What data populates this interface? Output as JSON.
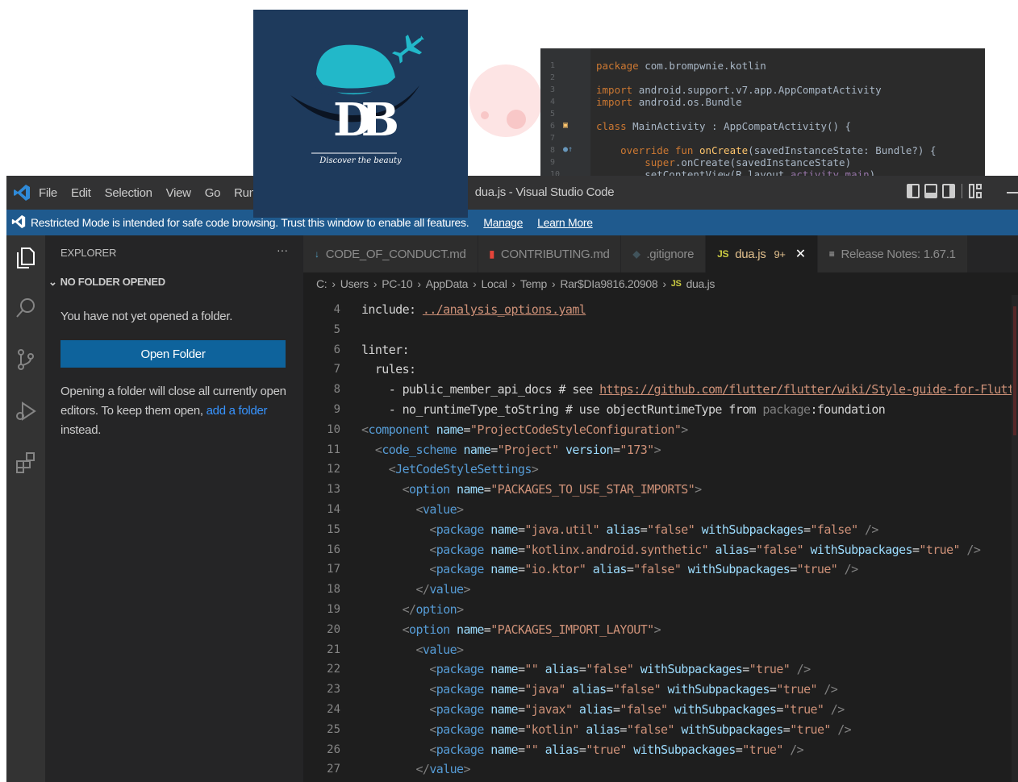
{
  "logo": {
    "tagline": "Discover the beauty",
    "letters": "DB"
  },
  "android_snippet": {
    "lines": [
      {
        "num": "1",
        "parts": [
          [
            "kw",
            "package "
          ],
          [
            "cls",
            "com.brompwnie.kotlin"
          ]
        ]
      },
      {
        "num": "2",
        "parts": []
      },
      {
        "num": "3",
        "parts": [
          [
            "kw",
            "import "
          ],
          [
            "cls",
            "android.support.v7.app.AppCompatActivity"
          ]
        ]
      },
      {
        "num": "4",
        "parts": [
          [
            "kw",
            "import "
          ],
          [
            "cls",
            "android.os.Bundle"
          ]
        ]
      },
      {
        "num": "5",
        "parts": []
      },
      {
        "num": "6",
        "parts": [
          [
            "kw",
            "class "
          ],
          [
            "cls",
            "MainActivity : AppCompatActivity() {"
          ]
        ]
      },
      {
        "num": "7",
        "parts": []
      },
      {
        "num": "8",
        "parts": [
          [
            "cls",
            "    "
          ],
          [
            "kw",
            "override fun "
          ],
          [
            "fn",
            "onCreate"
          ],
          [
            "cls",
            "(savedInstanceState: Bundle?) {"
          ]
        ]
      },
      {
        "num": "9",
        "parts": [
          [
            "cls",
            "        "
          ],
          [
            "kw",
            "super"
          ],
          [
            "cls",
            ".onCreate(savedInstanceState)"
          ]
        ]
      },
      {
        "num": "10",
        "parts": [
          [
            "cls",
            "        setContentView(R.layout."
          ],
          [
            "sup",
            "activity_main"
          ],
          [
            "cls",
            ")"
          ]
        ]
      }
    ]
  },
  "vscode": {
    "menu": [
      "File",
      "Edit",
      "Selection",
      "View",
      "Go",
      "Run"
    ],
    "window_title": "dua.js - Visual Studio Code",
    "restricted": {
      "text": "Restricted Mode is intended for safe code browsing. Trust this window to enable all features.",
      "manage": "Manage",
      "learn_more": "Learn More"
    },
    "sidebar": {
      "title": "EXPLORER",
      "more": "···",
      "section": "NO FOLDER OPENED",
      "message": "You have not yet opened a folder.",
      "open_button": "Open Folder",
      "note_before": "Opening a folder will close all currently open editors. To keep them open, ",
      "note_link": "add a folder",
      "note_after": " instead."
    },
    "tabs": [
      {
        "label": "CODE_OF_CONDUCT.md",
        "icon": "↓",
        "icon_color": "#519aba"
      },
      {
        "label": "CONTRIBUTING.md",
        "icon": "▮",
        "icon_color": "#e5453a"
      },
      {
        "label": ".gitignore",
        "icon": "◆",
        "icon_color": "#41535b"
      },
      {
        "label": "dua.js",
        "icon": "JS",
        "icon_color": "#cbcb41",
        "badge": "9+",
        "close": "✕"
      },
      {
        "label": "Release Notes: 1.67.1",
        "icon": "≡",
        "icon_color": "#cccccc"
      }
    ],
    "breadcrumb": [
      "C:",
      "Users",
      "PC-10",
      "AppData",
      "Local",
      "Temp",
      "Rar$DIa9816.20908"
    ],
    "breadcrumb_file": "dua.js",
    "breadcrumb_file_icon": "JS",
    "code_lines": [
      {
        "num": "4",
        "parts": [
          [
            "w",
            "include: "
          ],
          [
            "u",
            "../analysis_options.yaml"
          ]
        ]
      },
      {
        "num": "5",
        "parts": []
      },
      {
        "num": "6",
        "parts": [
          [
            "w",
            "linter:"
          ]
        ]
      },
      {
        "num": "7",
        "parts": [
          [
            "w",
            "  rules:"
          ]
        ]
      },
      {
        "num": "8",
        "parts": [
          [
            "w",
            "    - public_member_api_docs # see "
          ],
          [
            "u",
            "https://github.com/flutter/flutter/wiki/Style-guide-for-Flutte"
          ]
        ]
      },
      {
        "num": "9",
        "parts": [
          [
            "w",
            "    - no_runtimeType_toString # use objectRuntimeType from "
          ],
          [
            "p",
            "package"
          ],
          [
            "w",
            ":foundation"
          ]
        ]
      },
      {
        "num": "10",
        "parts": [
          [
            "p",
            "<"
          ],
          [
            "t",
            "component "
          ],
          [
            "a",
            "name"
          ],
          [
            "w",
            "="
          ],
          [
            "s",
            "\"ProjectCodeStyleConfiguration\""
          ],
          [
            "p",
            ">"
          ]
        ]
      },
      {
        "num": "11",
        "parts": [
          [
            "w",
            "  "
          ],
          [
            "p",
            "<"
          ],
          [
            "t",
            "code_scheme "
          ],
          [
            "a",
            "name"
          ],
          [
            "w",
            "="
          ],
          [
            "s",
            "\"Project\" "
          ],
          [
            "a",
            "version"
          ],
          [
            "w",
            "="
          ],
          [
            "s",
            "\"173\""
          ],
          [
            "p",
            ">"
          ]
        ]
      },
      {
        "num": "12",
        "parts": [
          [
            "w",
            "    "
          ],
          [
            "p",
            "<"
          ],
          [
            "t",
            "JetCodeStyleSettings"
          ],
          [
            "p",
            ">"
          ]
        ]
      },
      {
        "num": "13",
        "parts": [
          [
            "w",
            "      "
          ],
          [
            "p",
            "<"
          ],
          [
            "t",
            "option "
          ],
          [
            "a",
            "name"
          ],
          [
            "w",
            "="
          ],
          [
            "s",
            "\"PACKAGES_TO_USE_STAR_IMPORTS\""
          ],
          [
            "p",
            ">"
          ]
        ]
      },
      {
        "num": "14",
        "parts": [
          [
            "w",
            "        "
          ],
          [
            "p",
            "<"
          ],
          [
            "t",
            "value"
          ],
          [
            "p",
            ">"
          ]
        ]
      },
      {
        "num": "15",
        "parts": [
          [
            "w",
            "          "
          ],
          [
            "p",
            "<"
          ],
          [
            "t",
            "package "
          ],
          [
            "a",
            "name"
          ],
          [
            "w",
            "="
          ],
          [
            "s",
            "\"java.util\" "
          ],
          [
            "a",
            "alias"
          ],
          [
            "w",
            "="
          ],
          [
            "s",
            "\"false\" "
          ],
          [
            "a",
            "withSubpackages"
          ],
          [
            "w",
            "="
          ],
          [
            "s",
            "\"false\" "
          ],
          [
            "p",
            "/>"
          ]
        ]
      },
      {
        "num": "16",
        "parts": [
          [
            "w",
            "          "
          ],
          [
            "p",
            "<"
          ],
          [
            "t",
            "package "
          ],
          [
            "a",
            "name"
          ],
          [
            "w",
            "="
          ],
          [
            "s",
            "\"kotlinx.android.synthetic\" "
          ],
          [
            "a",
            "alias"
          ],
          [
            "w",
            "="
          ],
          [
            "s",
            "\"false\" "
          ],
          [
            "a",
            "withSubpackages"
          ],
          [
            "w",
            "="
          ],
          [
            "s",
            "\"true\" "
          ],
          [
            "p",
            "/>"
          ]
        ]
      },
      {
        "num": "17",
        "parts": [
          [
            "w",
            "          "
          ],
          [
            "p",
            "<"
          ],
          [
            "t",
            "package "
          ],
          [
            "a",
            "name"
          ],
          [
            "w",
            "="
          ],
          [
            "s",
            "\"io.ktor\" "
          ],
          [
            "a",
            "alias"
          ],
          [
            "w",
            "="
          ],
          [
            "s",
            "\"false\" "
          ],
          [
            "a",
            "withSubpackages"
          ],
          [
            "w",
            "="
          ],
          [
            "s",
            "\"true\" "
          ],
          [
            "p",
            "/>"
          ]
        ]
      },
      {
        "num": "18",
        "parts": [
          [
            "w",
            "        "
          ],
          [
            "p",
            "</"
          ],
          [
            "t",
            "value"
          ],
          [
            "p",
            ">"
          ]
        ]
      },
      {
        "num": "19",
        "parts": [
          [
            "w",
            "      "
          ],
          [
            "p",
            "</"
          ],
          [
            "t",
            "option"
          ],
          [
            "p",
            ">"
          ]
        ]
      },
      {
        "num": "20",
        "parts": [
          [
            "w",
            "      "
          ],
          [
            "p",
            "<"
          ],
          [
            "t",
            "option "
          ],
          [
            "a",
            "name"
          ],
          [
            "w",
            "="
          ],
          [
            "s",
            "\"PACKAGES_IMPORT_LAYOUT\""
          ],
          [
            "p",
            ">"
          ]
        ]
      },
      {
        "num": "21",
        "parts": [
          [
            "w",
            "        "
          ],
          [
            "p",
            "<"
          ],
          [
            "t",
            "value"
          ],
          [
            "p",
            ">"
          ]
        ]
      },
      {
        "num": "22",
        "parts": [
          [
            "w",
            "          "
          ],
          [
            "p",
            "<"
          ],
          [
            "t",
            "package "
          ],
          [
            "a",
            "name"
          ],
          [
            "w",
            "="
          ],
          [
            "s",
            "\"\" "
          ],
          [
            "a",
            "alias"
          ],
          [
            "w",
            "="
          ],
          [
            "s",
            "\"false\" "
          ],
          [
            "a",
            "withSubpackages"
          ],
          [
            "w",
            "="
          ],
          [
            "s",
            "\"true\" "
          ],
          [
            "p",
            "/>"
          ]
        ]
      },
      {
        "num": "23",
        "parts": [
          [
            "w",
            "          "
          ],
          [
            "p",
            "<"
          ],
          [
            "t",
            "package "
          ],
          [
            "a",
            "name"
          ],
          [
            "w",
            "="
          ],
          [
            "s",
            "\"java\" "
          ],
          [
            "a",
            "alias"
          ],
          [
            "w",
            "="
          ],
          [
            "s",
            "\"false\" "
          ],
          [
            "a",
            "withSubpackages"
          ],
          [
            "w",
            "="
          ],
          [
            "s",
            "\"true\" "
          ],
          [
            "p",
            "/>"
          ]
        ]
      },
      {
        "num": "24",
        "parts": [
          [
            "w",
            "          "
          ],
          [
            "p",
            "<"
          ],
          [
            "t",
            "package "
          ],
          [
            "a",
            "name"
          ],
          [
            "w",
            "="
          ],
          [
            "s",
            "\"javax\" "
          ],
          [
            "a",
            "alias"
          ],
          [
            "w",
            "="
          ],
          [
            "s",
            "\"false\" "
          ],
          [
            "a",
            "withSubpackages"
          ],
          [
            "w",
            "="
          ],
          [
            "s",
            "\"true\" "
          ],
          [
            "p",
            "/>"
          ]
        ]
      },
      {
        "num": "25",
        "parts": [
          [
            "w",
            "          "
          ],
          [
            "p",
            "<"
          ],
          [
            "t",
            "package "
          ],
          [
            "a",
            "name"
          ],
          [
            "w",
            "="
          ],
          [
            "s",
            "\"kotlin\" "
          ],
          [
            "a",
            "alias"
          ],
          [
            "w",
            "="
          ],
          [
            "s",
            "\"false\" "
          ],
          [
            "a",
            "withSubpackages"
          ],
          [
            "w",
            "="
          ],
          [
            "s",
            "\"true\" "
          ],
          [
            "p",
            "/>"
          ]
        ]
      },
      {
        "num": "26",
        "parts": [
          [
            "w",
            "          "
          ],
          [
            "p",
            "<"
          ],
          [
            "t",
            "package "
          ],
          [
            "a",
            "name"
          ],
          [
            "w",
            "="
          ],
          [
            "s",
            "\"\" "
          ],
          [
            "a",
            "alias"
          ],
          [
            "w",
            "="
          ],
          [
            "s",
            "\"true\" "
          ],
          [
            "a",
            "withSubpackages"
          ],
          [
            "w",
            "="
          ],
          [
            "s",
            "\"true\" "
          ],
          [
            "p",
            "/>"
          ]
        ]
      },
      {
        "num": "27",
        "parts": [
          [
            "w",
            "        "
          ],
          [
            "p",
            "</"
          ],
          [
            "t",
            "value"
          ],
          [
            "p",
            ">"
          ]
        ]
      }
    ]
  },
  "colors": {
    "accent": "#0e639c",
    "restricted_bar": "#1f5a8e",
    "logo_bg": "#1e3a5c",
    "logo_teal": "#22b8c9"
  }
}
